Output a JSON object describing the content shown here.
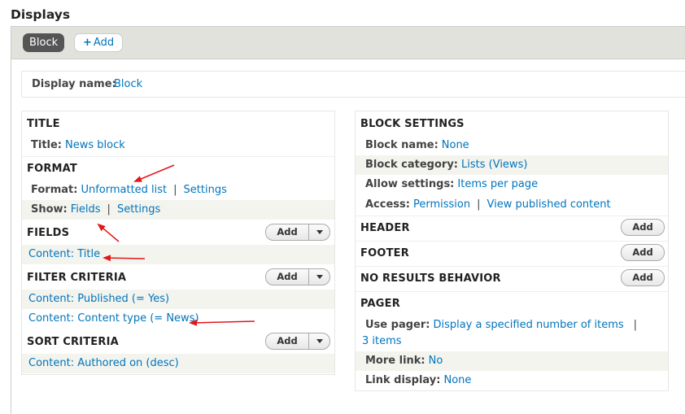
{
  "page_title": "Displays",
  "tabs": {
    "active": "Block",
    "add": "Add"
  },
  "display_name": {
    "label": "Display name:",
    "value": "Block"
  },
  "left": {
    "title": {
      "heading": "TITLE",
      "label": "Title:",
      "value": "News block"
    },
    "format": {
      "heading": "FORMAT",
      "format_label": "Format:",
      "format_value": "Unformatted list",
      "format_settings": "Settings",
      "show_label": "Show:",
      "show_value": "Fields",
      "show_settings": "Settings",
      "pipe": "|"
    },
    "fields": {
      "heading": "FIELDS",
      "add": "Add",
      "items": [
        "Content: Title"
      ]
    },
    "filter": {
      "heading": "FILTER CRITERIA",
      "add": "Add",
      "items": [
        "Content: Published (= Yes)",
        "Content: Content type (= News)"
      ]
    },
    "sort": {
      "heading": "SORT CRITERIA",
      "add": "Add",
      "items": [
        "Content: Authored on (desc)"
      ]
    }
  },
  "right": {
    "block_settings": {
      "heading": "BLOCK SETTINGS",
      "name_label": "Block name:",
      "name_value": "None",
      "category_label": "Block category:",
      "category_value": "Lists (Views)",
      "allow_label": "Allow settings:",
      "allow_value": "Items per page",
      "access_label": "Access:",
      "access_value": "Permission",
      "access_value2": "View published content",
      "pipe": "|"
    },
    "header": {
      "heading": "HEADER",
      "add": "Add"
    },
    "footer": {
      "heading": "FOOTER",
      "add": "Add"
    },
    "no_results": {
      "heading": "NO RESULTS BEHAVIOR",
      "add": "Add"
    },
    "pager": {
      "heading": "PAGER",
      "use_label": "Use pager:",
      "use_value": "Display a specified number of items",
      "use_value2": "3 items",
      "pipe": "|",
      "more_label": "More link:",
      "more_value": "No",
      "link_label": "Link display:",
      "link_value": "None"
    }
  },
  "colors": {
    "link": "#0074bd",
    "arrow": "#e3171b",
    "tab_bar": "#e1e2dc",
    "alt_row": "#f3f4ee"
  }
}
